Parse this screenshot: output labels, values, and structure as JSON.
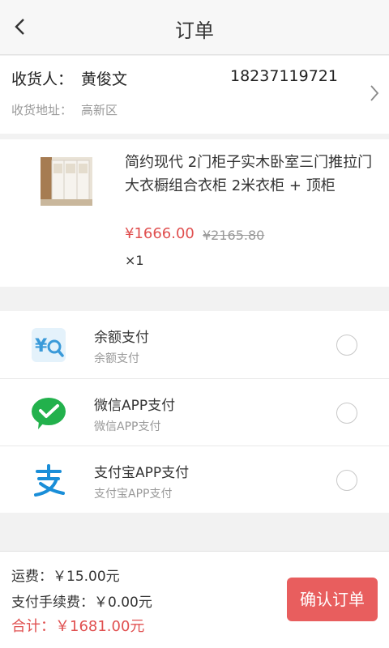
{
  "header": {
    "title": "订单",
    "back_icon": "chevron-left-icon"
  },
  "address": {
    "receiver_label": "收货人：",
    "receiver_name": "黄俊文",
    "phone": "18237119721",
    "address_label": "收货地址：",
    "address_value": "高新区",
    "arrow_icon": "chevron-right-icon"
  },
  "product": {
    "image": "wardrobe-product-image",
    "title": "简约现代 2门柜子实木卧室三门推拉门大衣橱组合衣柜 2米衣柜 + 顶柜",
    "price": "¥1666.00",
    "original_price": "¥2165.80",
    "quantity": "×1"
  },
  "payment_methods": [
    {
      "name": "余额支付",
      "subtitle": "余额支付",
      "icon": "balance-pay-icon",
      "selected": false
    },
    {
      "name": "微信APP支付",
      "subtitle": "微信APP支付",
      "icon": "wechat-pay-icon",
      "selected": false
    },
    {
      "name": "支付宝APP支付",
      "subtitle": "支付宝APP支付",
      "icon": "alipay-icon",
      "selected": false
    }
  ],
  "footer": {
    "shipping": "运费：￥15.00元",
    "service_fee": "支付手续费：￥0.00元",
    "total": "合计：￥1681.00元",
    "confirm_label": "确认订单"
  },
  "colors": {
    "accent_red": "#e05050",
    "button_red": "#e85e5e",
    "wechat_green": "#22b14c",
    "alipay_blue": "#1a8ed8"
  }
}
